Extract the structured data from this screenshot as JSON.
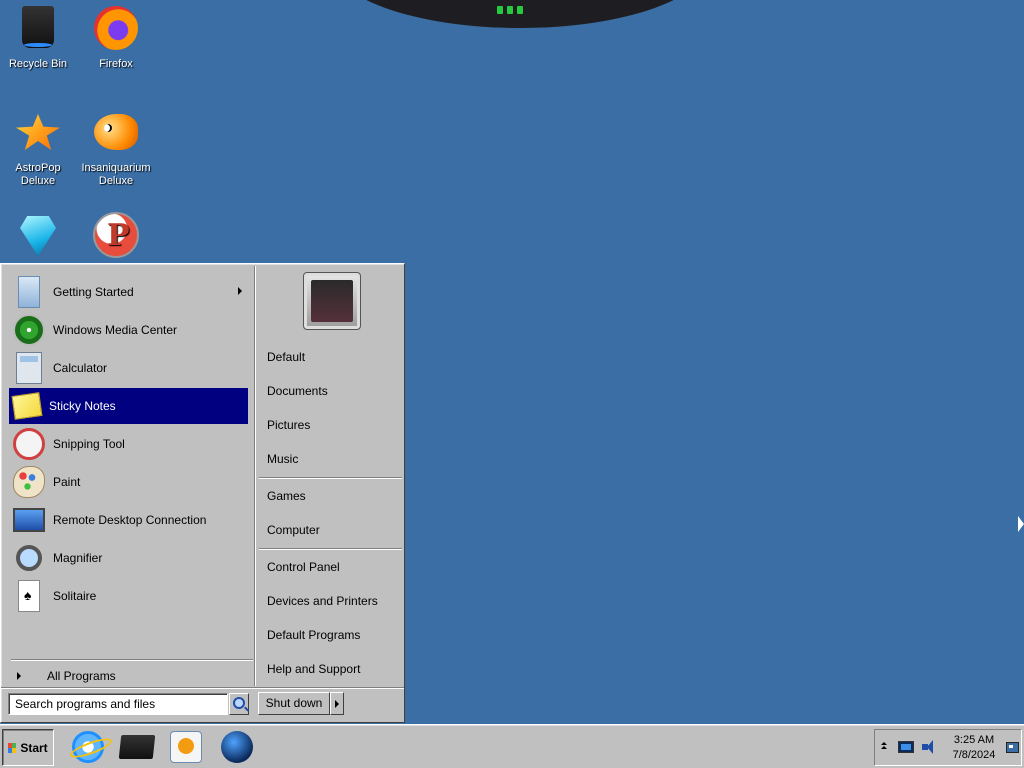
{
  "desktop": {
    "background_color": "#3a6ea5",
    "icons": [
      {
        "label": "Recycle Bin",
        "icon": "recycle-bin-icon"
      },
      {
        "label": "Firefox",
        "icon": "firefox-icon"
      },
      {
        "label": "AstroPop Deluxe",
        "icon": "astropop-icon"
      },
      {
        "label": "Insaniquarium Deluxe",
        "icon": "insaniquarium-icon"
      },
      {
        "label": "",
        "icon": "bejeweled-icon"
      },
      {
        "label": "",
        "icon": "peggle-icon"
      }
    ]
  },
  "start_menu": {
    "programs": [
      {
        "label": "Getting Started",
        "icon": "getting-started-icon",
        "has_submenu": true
      },
      {
        "label": "Windows Media Center",
        "icon": "media-center-icon"
      },
      {
        "label": "Calculator",
        "icon": "calculator-icon"
      },
      {
        "label": "Sticky Notes",
        "icon": "sticky-notes-icon",
        "selected": true
      },
      {
        "label": "Snipping Tool",
        "icon": "snipping-tool-icon"
      },
      {
        "label": "Paint",
        "icon": "paint-icon"
      },
      {
        "label": "Remote Desktop Connection",
        "icon": "remote-desktop-icon"
      },
      {
        "label": "Magnifier",
        "icon": "magnifier-icon"
      },
      {
        "label": "Solitaire",
        "icon": "solitaire-icon"
      }
    ],
    "all_programs_label": "All Programs",
    "places_group1": [
      "Default",
      "Documents",
      "Pictures",
      "Music"
    ],
    "places_group2": [
      "Games",
      "Computer"
    ],
    "places_group3": [
      "Control Panel",
      "Devices and Printers",
      "Default Programs",
      "Help and Support"
    ],
    "search_placeholder": "Search programs and files",
    "shutdown_label": "Shut down",
    "selection_color": "#000080"
  },
  "taskbar": {
    "start_label": "Start",
    "pinned": [
      {
        "icon": "internet-explorer-icon"
      },
      {
        "icon": "folder-icon"
      },
      {
        "icon": "media-player-icon"
      },
      {
        "icon": "globe-icon"
      }
    ],
    "clock_time": "3:25 AM",
    "clock_date": "7/8/2024"
  }
}
